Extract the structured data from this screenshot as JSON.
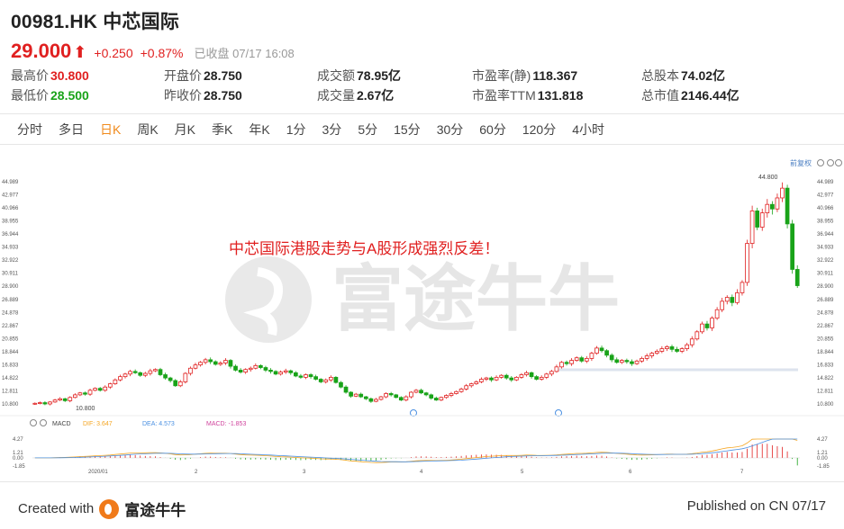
{
  "header": {
    "title": "00981.HK 中芯国际",
    "price": "29.000",
    "change": "+0.250",
    "change_pct": "+0.87%",
    "status": "已收盘 07/17 16:08"
  },
  "stats": {
    "high_label": "最高价",
    "high_value": "30.800",
    "low_label": "最低价",
    "low_value": "28.500",
    "open_label": "开盘价",
    "open_value": "28.750",
    "prev_label": "昨收价",
    "prev_value": "28.750",
    "turnover_label": "成交额",
    "turnover_value": "78.95亿",
    "volume_label": "成交量",
    "volume_value": "2.67亿",
    "pe_static_label": "市盈率(静)",
    "pe_static_value": "118.367",
    "pe_ttm_label": "市盈率TTM",
    "pe_ttm_value": "131.818",
    "shares_label": "总股本",
    "shares_value": "74.02亿",
    "mcap_label": "总市值",
    "mcap_value": "2146.44亿"
  },
  "tabs": [
    "分时",
    "多日",
    "日K",
    "周K",
    "月K",
    "季K",
    "年K",
    "1分",
    "3分",
    "5分",
    "15分",
    "30分",
    "60分",
    "120分",
    "4小时"
  ],
  "active_tab": 2,
  "chart": {
    "annotation": "中芯国际港股走势与A股形成强烈反差！",
    "watermark": "富途牛牛",
    "restore_label": "前复权",
    "y_ticks": [
      "44.989",
      "42.977",
      "40.966",
      "38.955",
      "36.944",
      "34.933",
      "32.922",
      "30.911",
      "28.900",
      "26.889",
      "24.878",
      "22.867",
      "20.855",
      "18.844",
      "16.833",
      "14.822",
      "12.811",
      "10.800"
    ],
    "high_marker": "44.800",
    "low_marker": "10.800",
    "macd_labels": {
      "name": "MACD",
      "dif": "DIF: 3.647",
      "dea": "DEA: 4.573",
      "macd": "MACD: -1.853"
    },
    "macd_ticks": [
      "4.27",
      "1.21",
      "0.00",
      "-1.85"
    ],
    "x_labels": [
      "2020/01",
      "2",
      "3",
      "4",
      "5",
      "6",
      "7"
    ],
    "colors": {
      "up": "#e02020",
      "down": "#19a319",
      "dif": "#f5a623",
      "dea": "#4a90e2",
      "macd": "#d0439d"
    }
  },
  "chart_data": {
    "type": "candlestick",
    "y_range": [
      10.8,
      44.989
    ],
    "months": [
      "2020/01",
      "2",
      "3",
      "4",
      "5",
      "6",
      "7"
    ],
    "closes": [
      10.9,
      11.0,
      10.8,
      11.1,
      11.4,
      11.6,
      11.3,
      11.8,
      12.2,
      12.5,
      12.3,
      12.9,
      13.2,
      12.9,
      13.4,
      13.9,
      14.5,
      15.0,
      15.4,
      15.8,
      15.6,
      15.2,
      15.5,
      15.9,
      16.1,
      15.3,
      14.8,
      14.4,
      13.6,
      14.2,
      15.5,
      16.3,
      16.8,
      17.2,
      17.6,
      17.3,
      16.9,
      17.1,
      17.5,
      16.6,
      16.0,
      15.7,
      16.1,
      16.3,
      16.7,
      16.4,
      16.0,
      15.8,
      15.4,
      15.7,
      15.9,
      15.6,
      15.1,
      14.9,
      15.3,
      15.0,
      14.6,
      14.2,
      14.5,
      14.9,
      14.1,
      13.4,
      12.6,
      12.0,
      12.3,
      11.9,
      11.6,
      11.2,
      11.5,
      11.9,
      12.4,
      12.2,
      11.8,
      11.4,
      11.9,
      12.6,
      12.9,
      12.5,
      12.2,
      11.7,
      11.4,
      11.8,
      12.1,
      12.4,
      12.7,
      13.1,
      13.6,
      13.9,
      14.2,
      14.6,
      14.8,
      14.5,
      14.9,
      15.2,
      14.8,
      14.5,
      14.9,
      15.3,
      15.6,
      15.0,
      14.6,
      14.9,
      15.4,
      15.8,
      16.5,
      17.2,
      17.0,
      17.5,
      17.9,
      17.4,
      17.8,
      18.6,
      19.4,
      19.0,
      18.3,
      17.6,
      17.2,
      17.5,
      17.3,
      17.0,
      17.4,
      17.8,
      18.2,
      18.6,
      18.9,
      19.3,
      19.6,
      19.2,
      18.9,
      19.3,
      19.9,
      20.8,
      21.9,
      23.1,
      22.5,
      24.0,
      25.3,
      26.6,
      27.2,
      26.4,
      27.9,
      29.5,
      35.5,
      40.5,
      38.0,
      40.2,
      41.5,
      40.8,
      42.5,
      44.0,
      38.5,
      31.5,
      29.0
    ],
    "macd": {
      "dif_last": 3.647,
      "dea_last": 4.573,
      "macd_last": -1.853,
      "range": [
        -1.85,
        4.27
      ]
    }
  }
}
